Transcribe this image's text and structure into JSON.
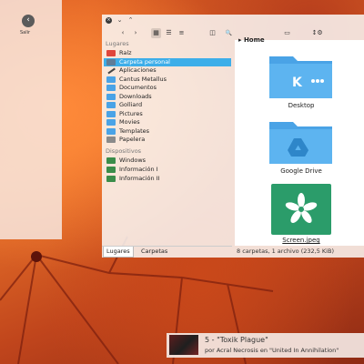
{
  "logout_panel": {
    "back_label": "Salir"
  },
  "window": {
    "controls": {
      "close": "×",
      "minimize": "⌄",
      "maximize": "⌃"
    },
    "toolbar": {
      "back": "‹",
      "forward": "›",
      "view_icons": "▦",
      "view_compact": "☰",
      "view_details": "≡",
      "split": "◫",
      "search": "🔍",
      "preview": "▭",
      "sort": "↕",
      "menu": "⚙"
    },
    "sidebar": {
      "places_title": "Lugares",
      "places": [
        {
          "label": "Raíz",
          "icon": "root-folder-icon"
        },
        {
          "label": "Carpeta personal",
          "icon": "home-folder-icon",
          "selected": true
        },
        {
          "label": "Aplicaciones",
          "icon": "applications-icon"
        },
        {
          "label": "Cantus Metallus",
          "icon": "folder-icon"
        },
        {
          "label": "Documentos",
          "icon": "folder-icon"
        },
        {
          "label": "Downloads",
          "icon": "folder-icon"
        },
        {
          "label": "Golliard",
          "icon": "folder-icon"
        },
        {
          "label": "Pictures",
          "icon": "folder-icon"
        },
        {
          "label": "Movies",
          "icon": "folder-icon"
        },
        {
          "label": "Templates",
          "icon": "folder-icon"
        },
        {
          "label": "Papelera",
          "icon": "trash-icon"
        }
      ],
      "devices_title": "Dispositivos",
      "devices": [
        {
          "label": "Windows",
          "icon": "drive-icon"
        },
        {
          "label": "Información I",
          "icon": "drive-icon"
        },
        {
          "label": "Información II",
          "icon": "drive-icon"
        }
      ],
      "tabs": [
        "Lugares",
        "Carpetas"
      ]
    },
    "main": {
      "breadcrumb": "Home",
      "files": [
        {
          "name": "Desktop",
          "icon": "kde-folder-icon"
        },
        {
          "name": "Google Drive",
          "icon": "google-drive-folder-icon"
        },
        {
          "name": "Screen.jpeg",
          "icon": "image-file-icon"
        }
      ],
      "status": "8 carpetas, 1 archivo (232,5 KiB)"
    }
  },
  "notification": {
    "track": "5 - \"Toxik Plague\"",
    "artist": "por Acral Necrosis en \"United In Annihilation\""
  },
  "colors": {
    "accent": "#3daee9",
    "selection": "#3daee9"
  }
}
